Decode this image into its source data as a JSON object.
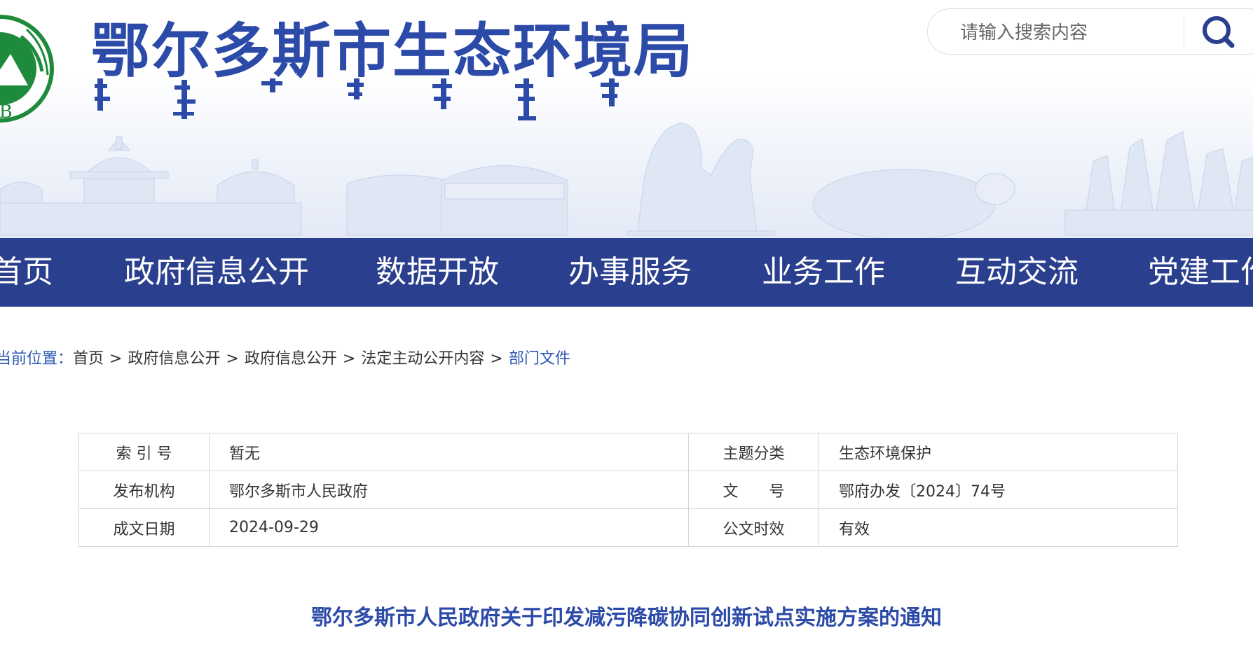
{
  "header": {
    "site_title": "鄂尔多斯市生态环境局",
    "logo_text": "HB",
    "search": {
      "placeholder": "请输入搜索内容",
      "value": ""
    }
  },
  "nav": {
    "items": [
      {
        "label": "首页"
      },
      {
        "label": "政府信息公开"
      },
      {
        "label": "数据开放"
      },
      {
        "label": "办事服务"
      },
      {
        "label": "业务工作"
      },
      {
        "label": "互动交流"
      },
      {
        "label": "党建工作"
      }
    ]
  },
  "breadcrumb": {
    "prefix": "当前位置：",
    "items": [
      "首页",
      "政府信息公开",
      "政府信息公开",
      "法定主动公开内容"
    ],
    "current": "部门文件",
    "separator": ">"
  },
  "metadata": {
    "rows": [
      {
        "label1": "索 引 号",
        "value1": "暂无",
        "label2": "主题分类",
        "value2": "生态环境保护"
      },
      {
        "label1": "发布机构",
        "value1": "鄂尔多斯市人民政府",
        "label2": "文　　号",
        "value2": "鄂府办发〔2024〕74号"
      },
      {
        "label1": "成文日期",
        "value1": "2024-09-29",
        "label2": "公文时效",
        "value2": "有效"
      }
    ]
  },
  "document": {
    "title": "鄂尔多斯市人民政府关于印发减污降碳协同创新试点实施方案的通知"
  },
  "colors": {
    "nav_bg": "#2a3f8d",
    "brand_blue": "#2c4aa8",
    "link_blue": "#2d57b3",
    "logo_green": "#1e8a3c"
  }
}
